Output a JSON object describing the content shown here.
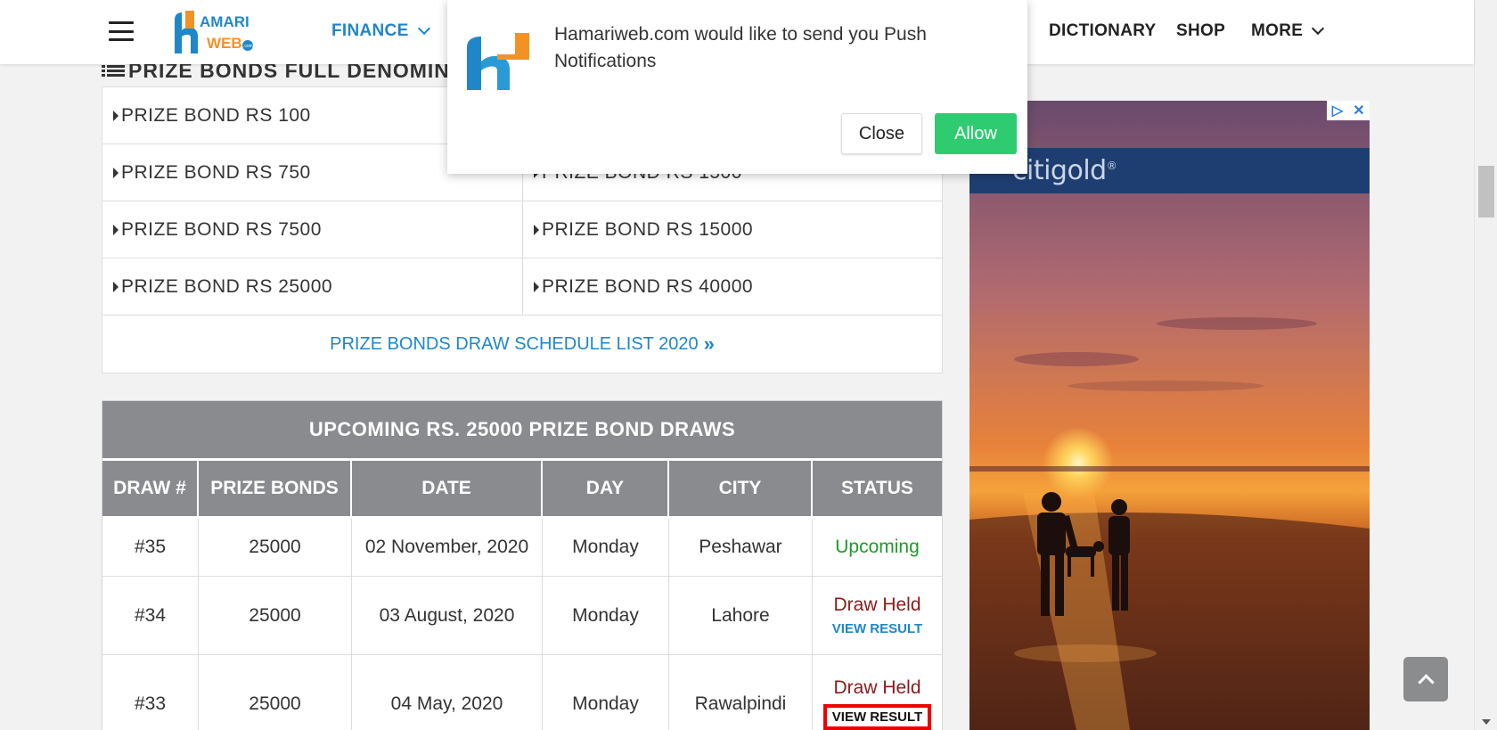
{
  "header": {
    "logo_text_top": "AMARI",
    "logo_text_bottom": "WEB",
    "logo_suffix": ".com",
    "nav": {
      "finance": "FINANCE",
      "dictionary": "DICTIONARY",
      "shop": "SHOP",
      "more": "MORE"
    }
  },
  "section": {
    "title": "PRIZE BONDS FULL DENOMINA"
  },
  "denominations": {
    "rows": [
      [
        "PRIZE BOND RS 100",
        ""
      ],
      [
        "PRIZE BOND RS 750",
        "PRIZE BOND RS 1500"
      ],
      [
        "PRIZE BOND RS 7500",
        "PRIZE BOND RS 15000"
      ],
      [
        "PRIZE BOND RS 25000",
        "PRIZE BOND RS 40000"
      ]
    ],
    "schedule_link": "PRIZE BONDS DRAW SCHEDULE LIST 2020"
  },
  "draws": {
    "title": "UPCOMING RS. 25000 PRIZE BOND DRAWS",
    "headers": [
      "DRAW #",
      "PRIZE BONDS",
      "DATE",
      "DAY",
      "CITY",
      "STATUS"
    ],
    "rows": [
      {
        "draw": "#35",
        "bonds": "25000",
        "date": "02 November, 2020",
        "day": "Monday",
        "city": "Peshawar",
        "status": "Upcoming"
      },
      {
        "draw": "#34",
        "bonds": "25000",
        "date": "03 August, 2020",
        "day": "Monday",
        "city": "Lahore",
        "status": "Draw Held",
        "action": "VIEW RESULT"
      },
      {
        "draw": "#33",
        "bonds": "25000",
        "date": "04 May, 2020",
        "day": "Monday",
        "city": "Rawalpindi",
        "status": "Draw Held",
        "action": "VIEW RESULT"
      }
    ]
  },
  "ad": {
    "brand": "citigold",
    "brand_mark": "®"
  },
  "popup": {
    "message": "Hamariweb.com would like to send you Push Notifications",
    "close_label": "Close",
    "allow_label": "Allow"
  },
  "colors": {
    "accent": "#1f87c8",
    "table_header": "#8a8b8e",
    "upcoming": "#1f9a2b",
    "held": "#8b1a1a",
    "allow": "#2fcb70",
    "highlight": "#ee0000"
  },
  "icons": {
    "menu": "hamburger-icon",
    "list": "list-icon",
    "chevron": "chevron-down-icon",
    "caret": "caret-right-icon",
    "double_chevron": "double-chevron-right-icon",
    "ad_choices": "adchoices-icon",
    "ad_close": "close-icon",
    "back_to_top": "chevron-up-icon"
  }
}
